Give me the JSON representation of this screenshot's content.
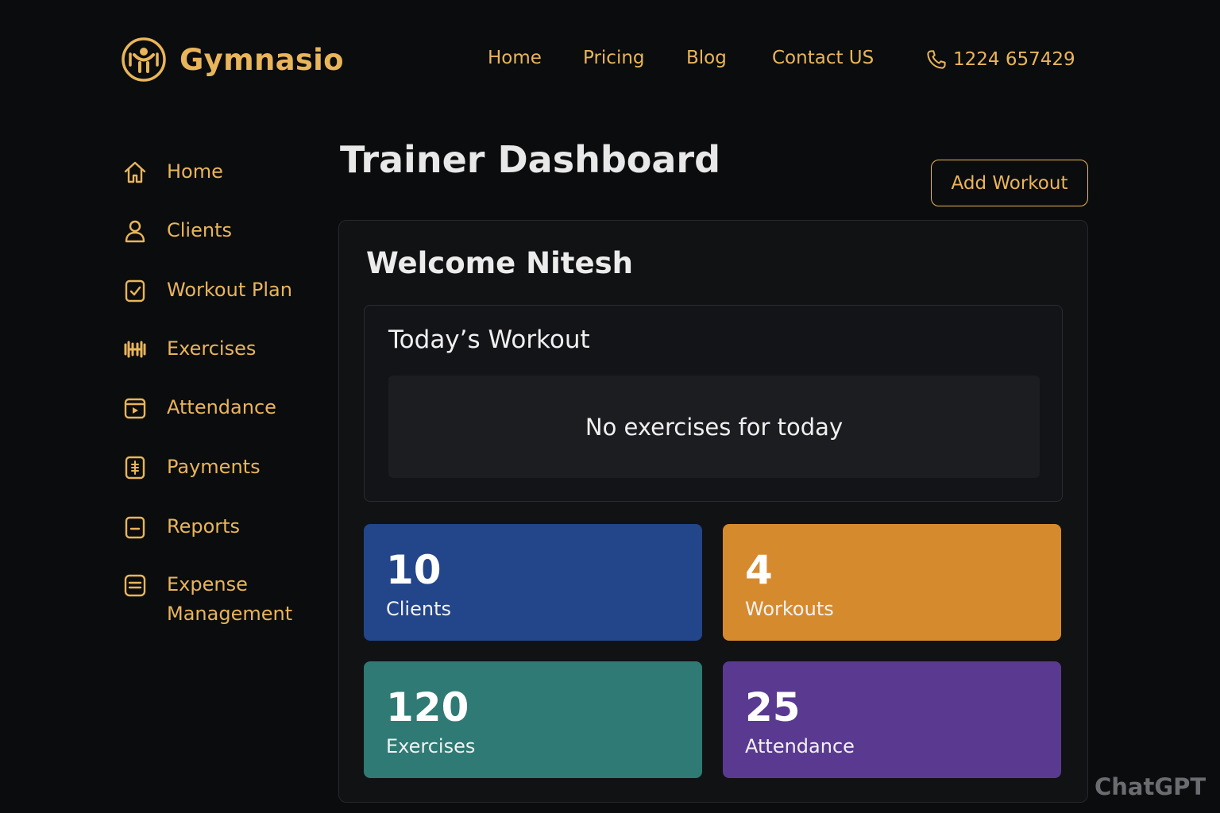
{
  "header": {
    "brand": "Gymnasio",
    "nav": [
      "Home",
      "Pricing",
      "Blog",
      "Contact US"
    ],
    "phone": "1224 657429"
  },
  "sidebar": {
    "items": [
      {
        "label": "Home",
        "icon": "home-icon"
      },
      {
        "label": "Clients",
        "icon": "user-icon"
      },
      {
        "label": "Workout Plan",
        "icon": "clipboard-check-icon"
      },
      {
        "label": "Exercises",
        "icon": "dumbbell-icon"
      },
      {
        "label": "Attendance",
        "icon": "calendar-play-icon"
      },
      {
        "label": "Payments",
        "icon": "payment-icon"
      },
      {
        "label": "Reports",
        "icon": "report-icon"
      },
      {
        "label": "Expense Management",
        "icon": "expense-icon"
      }
    ]
  },
  "main": {
    "title": "Trainer Dashboard",
    "add_button": "Add Workout",
    "welcome": "Welcome Nitesh",
    "today": {
      "title": "Today’s Workout",
      "empty_text": "No exercises for today"
    },
    "stats": [
      {
        "value": "10",
        "label": "Clients",
        "color": "#23458a"
      },
      {
        "value": "4",
        "label": "Workouts",
        "color": "#d68a2e"
      },
      {
        "value": "120",
        "label": "Exercises",
        "color": "#2f7a74"
      },
      {
        "value": "25",
        "label": "Attendance",
        "color": "#5a3a90"
      }
    ]
  },
  "watermark": "ChatGPT",
  "colors": {
    "accent": "#e9b55a",
    "background": "#0b0c0e"
  }
}
